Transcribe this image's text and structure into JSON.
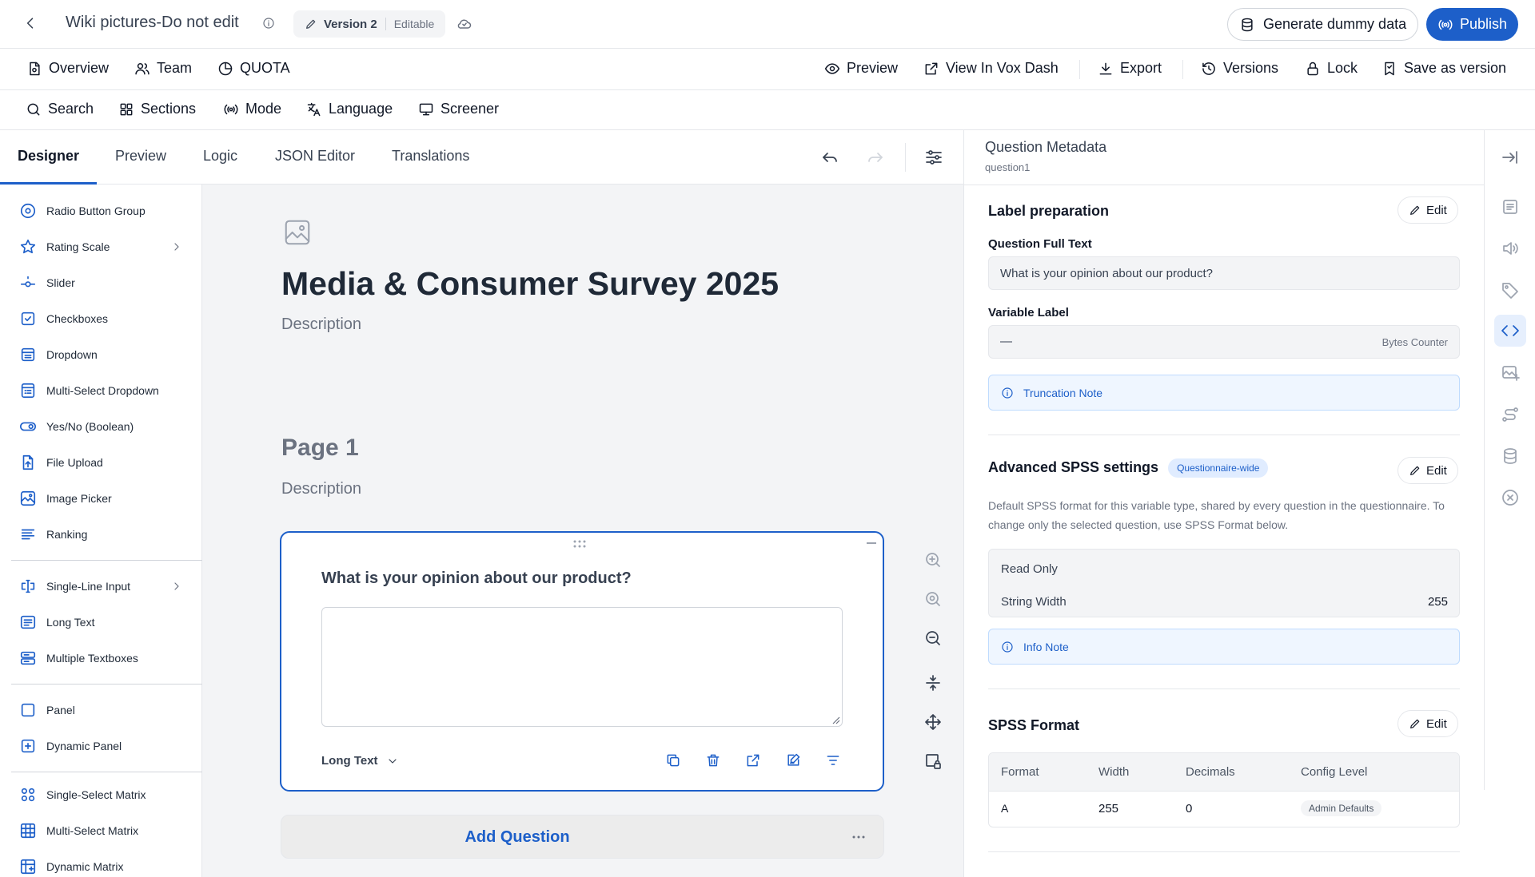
{
  "header": {
    "title": "Wiki pictures-Do not edit",
    "version_label": "Version 2",
    "version_status": "Editable",
    "generate_label": "Generate dummy data",
    "publish_label": "Publish"
  },
  "nav_left": [
    "Overview",
    "Team",
    "QUOTA"
  ],
  "nav_right": [
    "Preview",
    "View In Vox Dash",
    "Export",
    "Versions",
    "Lock",
    "Save as version"
  ],
  "toolbar": [
    "Search",
    "Sections",
    "Mode",
    "Language",
    "Screener"
  ],
  "tabs": [
    "Designer",
    "Preview",
    "Logic",
    "JSON Editor",
    "Translations"
  ],
  "sidebar": {
    "items": [
      {
        "label": "Radio Button Group",
        "icon": "radio-icon"
      },
      {
        "label": "Rating Scale",
        "icon": "star-icon"
      },
      {
        "label": "Slider",
        "icon": "slider-icon"
      },
      {
        "label": "Checkboxes",
        "icon": "checkbox-icon"
      },
      {
        "label": "Dropdown",
        "icon": "dropdown-icon"
      },
      {
        "label": "Multi-Select Dropdown",
        "icon": "multi-dropdown-icon"
      },
      {
        "label": "Yes/No (Boolean)",
        "icon": "toggle-icon"
      },
      {
        "label": "File Upload",
        "icon": "upload-icon"
      },
      {
        "label": "Image Picker",
        "icon": "image-picker-icon"
      },
      {
        "label": "Ranking",
        "icon": "ranking-icon"
      },
      {
        "label": "Single-Line Input",
        "icon": "text-cursor-icon"
      },
      {
        "label": "Long Text",
        "icon": "long-text-icon"
      },
      {
        "label": "Multiple Textboxes",
        "icon": "textboxes-icon"
      },
      {
        "label": "Panel",
        "icon": "panel-icon"
      },
      {
        "label": "Dynamic Panel",
        "icon": "dynamic-panel-icon"
      },
      {
        "label": "Single-Select Matrix",
        "icon": "matrix-icon"
      },
      {
        "label": "Multi-Select Matrix",
        "icon": "grid-icon"
      },
      {
        "label": "Dynamic Matrix",
        "icon": "dynamic-matrix-icon"
      }
    ]
  },
  "canvas": {
    "survey_title": "Media & Consumer Survey 2025",
    "survey_description": "Description",
    "page_title": "Page 1",
    "page_description": "Description",
    "question_text": "What is your opinion about our product?",
    "question_type": "Long Text",
    "add_question_label": "Add Question",
    "more_label": "···"
  },
  "panel": {
    "title": "Question Metadata",
    "subtitle": "question1",
    "label_prep": {
      "title": "Label preparation",
      "edit_label": "Edit",
      "full_text_label": "Question Full Text",
      "full_text_value": "What is your opinion about our product?",
      "variable_label": "Variable Label",
      "variable_value": "—",
      "bytes_counter": "Bytes Counter",
      "truncation_note": "Truncation Note"
    },
    "advanced": {
      "title": "Advanced SPSS settings",
      "badge": "Questionnaire-wide",
      "edit_label": "Edit",
      "description": "Default SPSS format for this variable type, shared by every question in the questionnaire. To change only the selected question, use SPSS Format below.",
      "read_only": "Read Only",
      "string_width_label": "String Width",
      "string_width_value": "255",
      "info_note": "Info Note"
    },
    "spss_format": {
      "title": "SPSS Format",
      "edit_label": "Edit",
      "columns": [
        "Format",
        "Width",
        "Decimals",
        "Config Level"
      ],
      "row": [
        "A",
        "255",
        "0",
        "Admin Defaults"
      ]
    }
  },
  "colors": {
    "accent": "#1d5fc9",
    "canvas_bg": "#f3f4f6",
    "note_bg": "#eff6ff"
  }
}
